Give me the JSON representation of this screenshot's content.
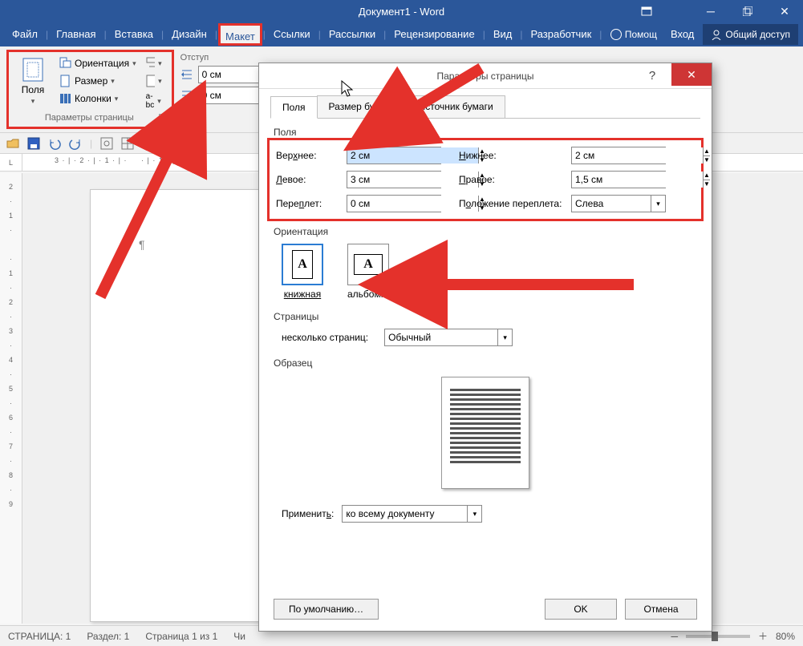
{
  "titlebar": {
    "title": "Документ1 - Word"
  },
  "menubar": {
    "file": "Файл",
    "tabs": [
      "Главная",
      "Вставка",
      "Дизайн",
      "Макет",
      "Ссылки",
      "Рассылки",
      "Рецензирование",
      "Вид",
      "Разработчик"
    ],
    "active_index": 3,
    "help": "Помощ",
    "login": "Вход",
    "share": "Общий доступ"
  },
  "ribbon": {
    "group_page_setup": {
      "title": "Параметры страницы",
      "margins": "Поля",
      "orientation": "Ориентация",
      "size": "Размер",
      "columns": "Колонки"
    },
    "group_indent": {
      "title": "Отступ",
      "val1": "0 см",
      "val2": "0 см"
    }
  },
  "statusbar": {
    "page": "СТРАНИЦА: 1",
    "section": "Раздел: 1",
    "pages": "Страница 1 из 1",
    "words": "Чи",
    "zoom": "80%"
  },
  "dialog": {
    "title": "Параметры страницы",
    "tabs": [
      "Поля",
      "Размер бумаги",
      "Источник бумаги"
    ],
    "active_tab": 0,
    "margins": {
      "legend": "Поля",
      "top_label": "Верхнее:",
      "top_value": "2 см",
      "bottom_label": "Нижнее:",
      "bottom_value": "2 см",
      "left_label": "Левое:",
      "left_value": "3 см",
      "right_label": "Правое:",
      "right_value": "1,5 см",
      "gutter_label": "Переплет:",
      "gutter_value": "0 см",
      "gutter_pos_label": "Положение переплета:",
      "gutter_pos_value": "Слева"
    },
    "orientation": {
      "legend": "Ориентация",
      "portrait": "книжная",
      "landscape": "альбомная"
    },
    "pages": {
      "legend": "Страницы",
      "label": "несколько страниц:",
      "value": "Обычный"
    },
    "sample_legend": "Образец",
    "apply": {
      "label": "Применить:",
      "value": "ко всему документу"
    },
    "buttons": {
      "default": "По умолчанию…",
      "ok": "OK",
      "cancel": "Отмена"
    }
  }
}
